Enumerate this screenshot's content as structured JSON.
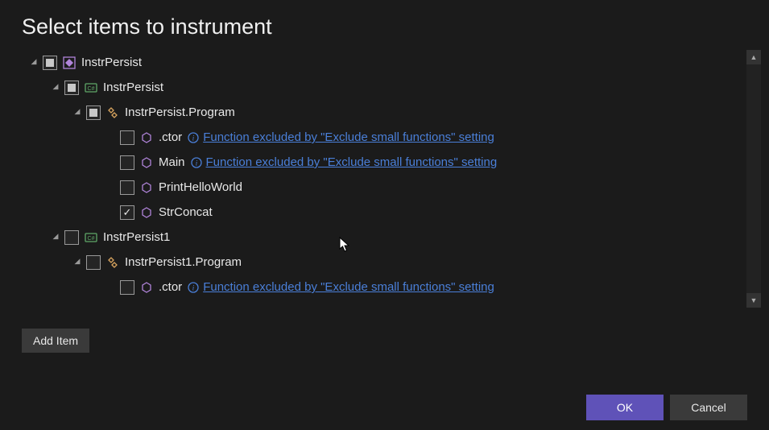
{
  "title": "Select items to instrument",
  "tree": {
    "solution": {
      "label": "InstrPersist",
      "projects": [
        {
          "label": "InstrPersist",
          "classes": [
            {
              "label": "InstrPersist.Program",
              "methods": [
                {
                  "label": ".ctor",
                  "excluded": true,
                  "checked": false
                },
                {
                  "label": "Main",
                  "excluded": true,
                  "checked": false
                },
                {
                  "label": "PrintHelloWorld",
                  "excluded": false,
                  "checked": false
                },
                {
                  "label": "StrConcat",
                  "excluded": false,
                  "checked": true
                }
              ]
            }
          ]
        },
        {
          "label": "InstrPersist1",
          "classes": [
            {
              "label": "InstrPersist1.Program",
              "methods": [
                {
                  "label": ".ctor",
                  "excluded": true,
                  "checked": false
                }
              ]
            }
          ]
        }
      ]
    }
  },
  "excluded_message": "Function excluded by \"Exclude small functions\" setting",
  "buttons": {
    "add_item": "Add Item",
    "ok": "OK",
    "cancel": "Cancel"
  },
  "colors": {
    "accent": "#5f52b8",
    "link": "#4a7fd8",
    "icon_purple": "#b084d9",
    "icon_green": "#5fa868"
  }
}
